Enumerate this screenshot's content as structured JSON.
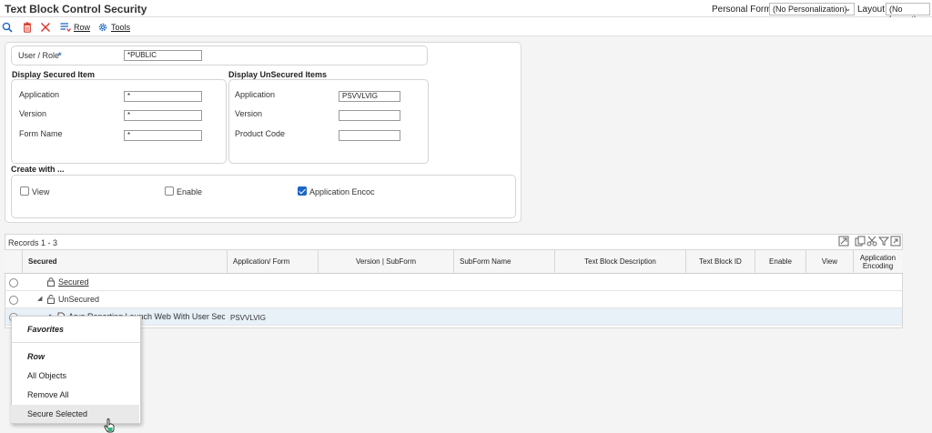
{
  "window": {
    "title": "Text Block Control Security",
    "personal_form_label": "Personal Form:",
    "personal_form_value": "(No Personalization)",
    "layout_label": "Layout:",
    "layout_value": "(No Layout)"
  },
  "toolbar": {
    "row_label": "Row",
    "tools_label": "Tools",
    "icons": [
      "search-icon",
      "delete-icon",
      "close-icon",
      "row-menu-icon",
      "gear-icon"
    ]
  },
  "header_form": {
    "user_role_label": "User / Role",
    "required_marker": "*",
    "user_role_value": "*PUBLIC"
  },
  "secured": {
    "title": "Display Secured Item",
    "application_label": "Application",
    "application_value": "*",
    "version_label": "Version",
    "version_value": "*",
    "form_name_label": "Form Name",
    "form_name_value": "*"
  },
  "unsecured": {
    "title": "Display UnSecured Items",
    "application_label": "Application",
    "application_value": "PSVVLVIG",
    "version_label": "Version",
    "version_value": "",
    "product_code_label": "Product Code",
    "product_code_value": ""
  },
  "create_with": {
    "title": "Create with ...",
    "view_label": "View",
    "view_checked": false,
    "enable_label": "Enable",
    "enable_checked": false,
    "application_encoding_label": "Application Encoc",
    "application_encoding_checked": true
  },
  "grid": {
    "records_label": "Records 1 - 3",
    "columns": [
      "Secured",
      "Application/ Form",
      "Version | SubForm",
      "SubForm Name",
      "Text Block Description",
      "Text Block ID",
      "Enable",
      "View",
      "Application Encoding"
    ],
    "rows": [
      {
        "tree_label": "Secured",
        "application": "",
        "selected": false
      },
      {
        "tree_label": "UnSecured",
        "application": "",
        "selected": false
      },
      {
        "tree_label": "Arya Reporting Launch Web With User Secu...",
        "application": "PSVVLVIG",
        "selected": true
      }
    ]
  },
  "context_menu": {
    "favorites": "Favorites",
    "row_header": "Row",
    "all_objects": "All Objects",
    "remove_all": "Remove All",
    "secure_selected": "Secure Selected"
  },
  "colors": {
    "accent": "#1e66c5",
    "delete_red": "#d9382c",
    "selected_row": "#e8f0f8"
  }
}
